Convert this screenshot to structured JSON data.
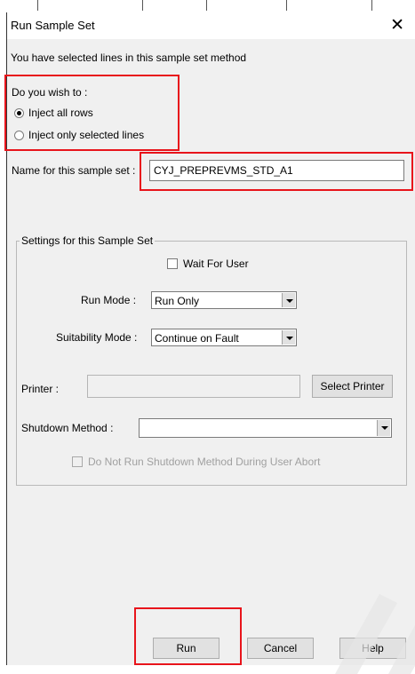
{
  "dialog": {
    "title": "Run Sample Set",
    "close_glyph": "✕",
    "intro_text": "You have selected lines in this sample set method"
  },
  "inject": {
    "question": "Do you wish to :",
    "options": [
      {
        "label": "Inject all rows",
        "selected": true
      },
      {
        "label": "Inject only selected lines",
        "selected": false
      }
    ]
  },
  "sample_set": {
    "name_label": "Name for this sample set :",
    "name_value": "CYJ_PREPREVMS_STD_A1"
  },
  "settings": {
    "group_title": "Settings for this Sample Set",
    "wait_for_user_label": "Wait For User",
    "run_mode_label": "Run Mode :",
    "run_mode_value": "Run Only",
    "suitability_label": "Suitability Mode :",
    "suitability_value": "Continue on Fault",
    "printer_label": "Printer :",
    "printer_value": "",
    "select_printer_label": "Select Printer",
    "shutdown_label": "Shutdown Method :",
    "shutdown_value": "",
    "no_shutdown_label": "Do Not Run Shutdown Method During User Abort"
  },
  "buttons": {
    "run": "Run",
    "cancel": "Cancel",
    "help": "Help"
  },
  "colors": {
    "highlight": "#e8141b",
    "dialog_bg": "#f0f0f0"
  },
  "icons": [
    "close-icon",
    "dropdown-arrow-icon"
  ]
}
